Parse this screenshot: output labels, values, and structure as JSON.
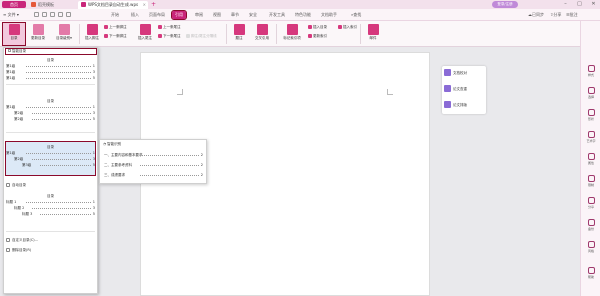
{
  "colors": {
    "accent": "#c9257a",
    "selection_outline": "#8b0a2c",
    "highlight_bg": "#dce9f7",
    "pane_icon": "#8a6bd6"
  },
  "titlebar": {
    "home_tab": "首页",
    "tabs": [
      {
        "label": "稻壳模板",
        "icon": "docer-icon"
      },
      {
        "label": "WPS文档目录自动生成.wps",
        "icon": "wps-doc-icon"
      }
    ],
    "new_tab": "+",
    "login": "登录/注册",
    "controls": [
      "–",
      "□",
      "✕"
    ]
  },
  "ribbon": {
    "menu": "≡ 文件 ▾",
    "tabs": [
      "开始",
      "插入",
      "页面布局",
      "引用",
      "审阅",
      "视图",
      "章节",
      "安全",
      "开发工具",
      "特色功能",
      "文档助手"
    ],
    "active_tab": "引用",
    "search": "查找",
    "right_items": [
      "已同步",
      "分享",
      "批注"
    ],
    "buttons": {
      "toc": "目录",
      "update_toc": "更新目录",
      "toc_level": "目录级别▾",
      "insert_footnote": "插入脚注",
      "prev_footnote": "上一条脚注",
      "next_footnote": "下一条脚注",
      "insert_endnote": "插入尾注",
      "prev_endnote": "上一条尾注",
      "next_endnote": "下一条尾注",
      "note_separator": "脚注/尾注分隔线",
      "caption": "题注",
      "cross_ref": "交叉引用",
      "mark_entry": "标记索引项",
      "insert_index": "插入目录",
      "insert_index2": "插入索引",
      "update_index": "更新索引",
      "mail": "邮件"
    }
  },
  "toc_menu": {
    "smart_toc": "智能目录",
    "block1": {
      "title": "目录",
      "lines": [
        [
          "第1级",
          "1"
        ],
        [
          "第1级",
          "3"
        ],
        [
          "第1级",
          "5"
        ]
      ]
    },
    "block2": {
      "title": "目录",
      "lines": [
        [
          "第1级",
          "1"
        ],
        [
          "第2级",
          "3"
        ],
        [
          "第2级",
          "5"
        ]
      ]
    },
    "block3": {
      "title": "目录",
      "lines": [
        [
          "第1级",
          "1"
        ],
        [
          "第2级",
          "3"
        ],
        [
          "第3级",
          "5"
        ]
      ]
    },
    "auto_toc": "自动目录",
    "block4": {
      "title": "目录",
      "lines": [
        [
          "标题 1",
          "1"
        ],
        [
          "标题 2",
          "3"
        ],
        [
          "标题 3",
          "5"
        ]
      ]
    },
    "custom_toc": "自定义目录(C)...",
    "delete_toc": "删除目录(R)"
  },
  "preview": {
    "title": "智能识别",
    "lines": [
      [
        "一、主要内容和基本要求",
        "2"
      ],
      [
        "二、主要参考资料",
        "2"
      ],
      [
        "三、成绩要求",
        "2"
      ]
    ]
  },
  "tool_pane": {
    "items": [
      {
        "label": "文档校对",
        "icon": "proofread-icon"
      },
      {
        "label": "论文查重",
        "icon": "plagiarism-icon"
      },
      {
        "label": "论文排版",
        "icon": "typeset-icon"
      }
    ]
  },
  "right_sidebar": {
    "items": [
      "样式",
      "选择",
      "形状",
      "艺术字",
      "属性",
      "限制",
      "分享",
      "备份",
      "风格",
      "帮助"
    ]
  }
}
